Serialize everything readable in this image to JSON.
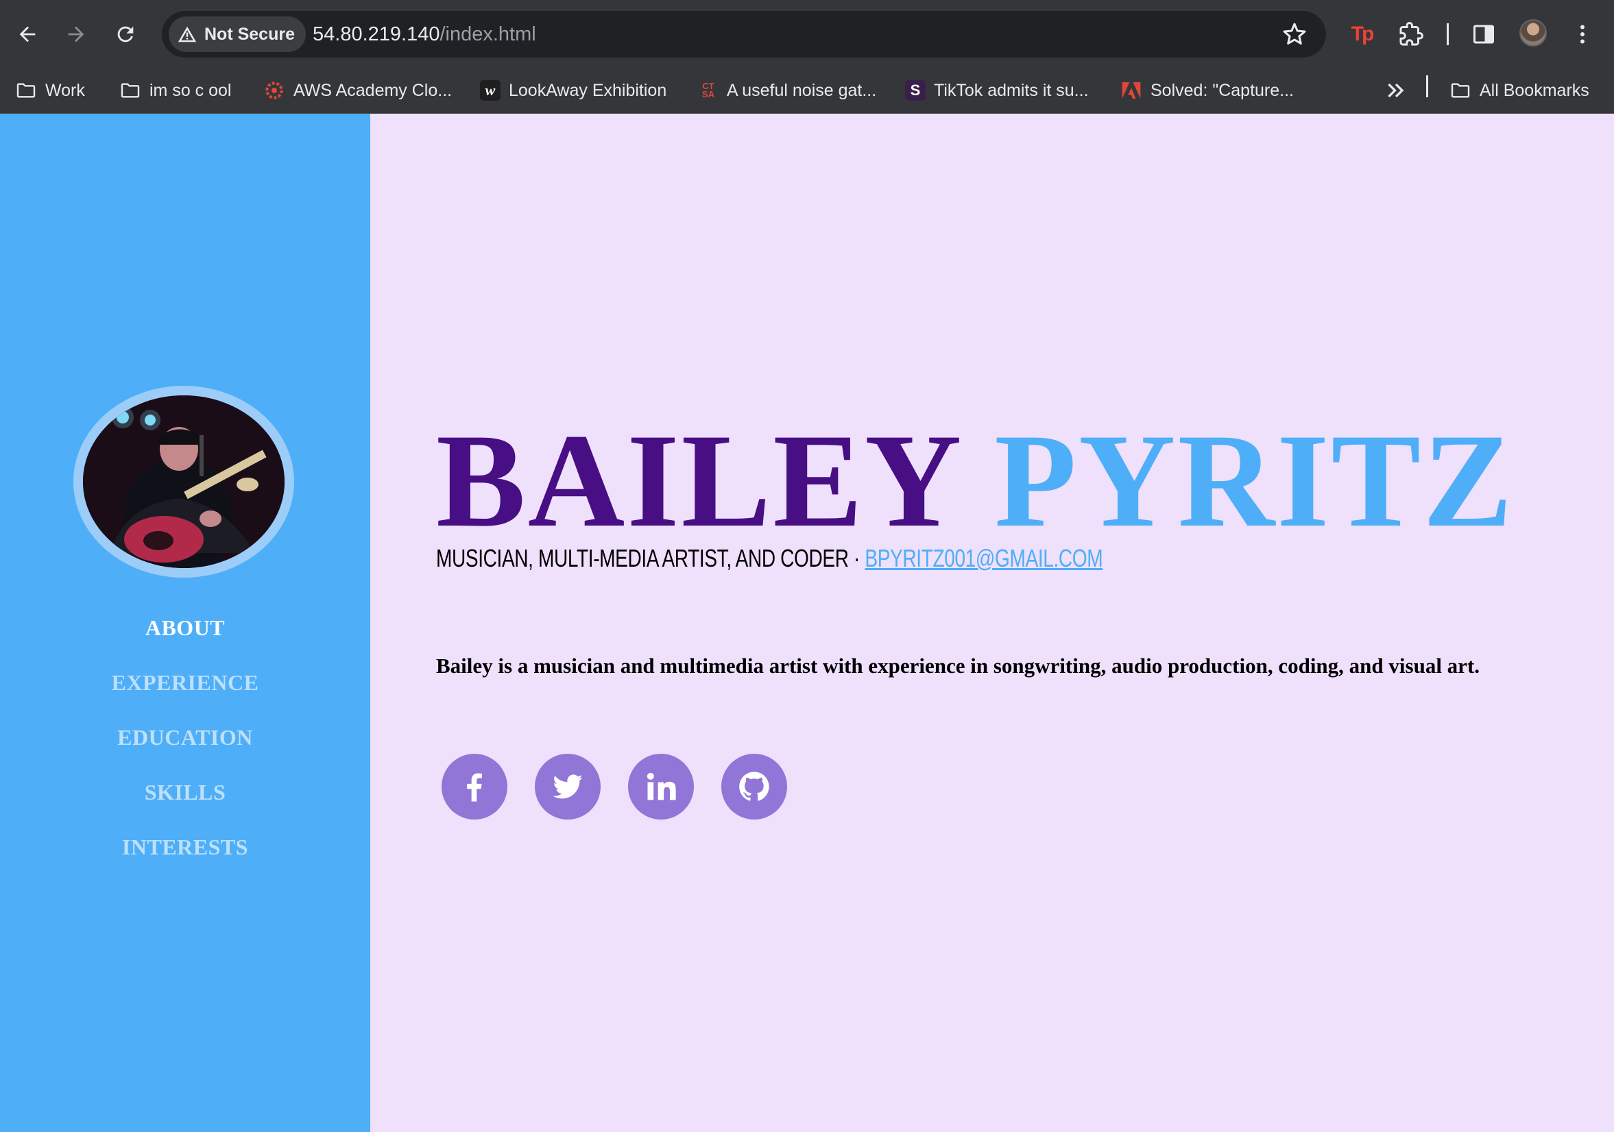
{
  "browser": {
    "security_label": "Not Secure",
    "url_host": "54.80.219.140",
    "url_path": "/index.html",
    "icons": [
      "back-icon",
      "forward-icon",
      "reload-icon",
      "warning-icon",
      "star-icon",
      "extension-tp-icon",
      "puzzle-icon",
      "side-panel-icon",
      "profile-avatar",
      "menu-icon"
    ],
    "tp_extension_label": "Tp",
    "bookmarks": [
      {
        "label": "Work",
        "icon": "folder-icon"
      },
      {
        "label": "im so c ool",
        "icon": "folder-icon"
      },
      {
        "label": "AWS Academy Clo...",
        "icon": "canvas-favicon"
      },
      {
        "label": "LookAway Exhibition",
        "icon": "w-favicon"
      },
      {
        "label": "A useful noise gat...",
        "icon": "ctsa-favicon"
      },
      {
        "label": "TikTok admits it su...",
        "icon": "s-favicon"
      },
      {
        "label": "Solved: \"Capture...",
        "icon": "adobe-favicon"
      }
    ],
    "all_bookmarks": "All Bookmarks"
  },
  "sidebar": {
    "nav": [
      {
        "label": "ABOUT",
        "active": true
      },
      {
        "label": "EXPERIENCE",
        "active": false
      },
      {
        "label": "EDUCATION",
        "active": false
      },
      {
        "label": "SKILLS",
        "active": false
      },
      {
        "label": "INTERESTS",
        "active": false
      }
    ]
  },
  "hero": {
    "first_name": "BAILEY",
    "last_name": "PYRITZ",
    "roles": "Musician, Multi-Media Artist, and Coder",
    "separator": " · ",
    "email": "bpyritz001@gmail.com",
    "bio": "Bailey is a musician and multimedia artist with experience in songwriting, audio production, coding, and visual art.",
    "socials": [
      "facebook-icon",
      "twitter-icon",
      "linkedin-icon",
      "github-icon"
    ]
  },
  "colors": {
    "sidebar_bg": "#4eaef8",
    "page_bg": "#efe0fb",
    "first_name": "#470f83",
    "accent": "#4eaef8",
    "social_bg": "#9176d7"
  }
}
